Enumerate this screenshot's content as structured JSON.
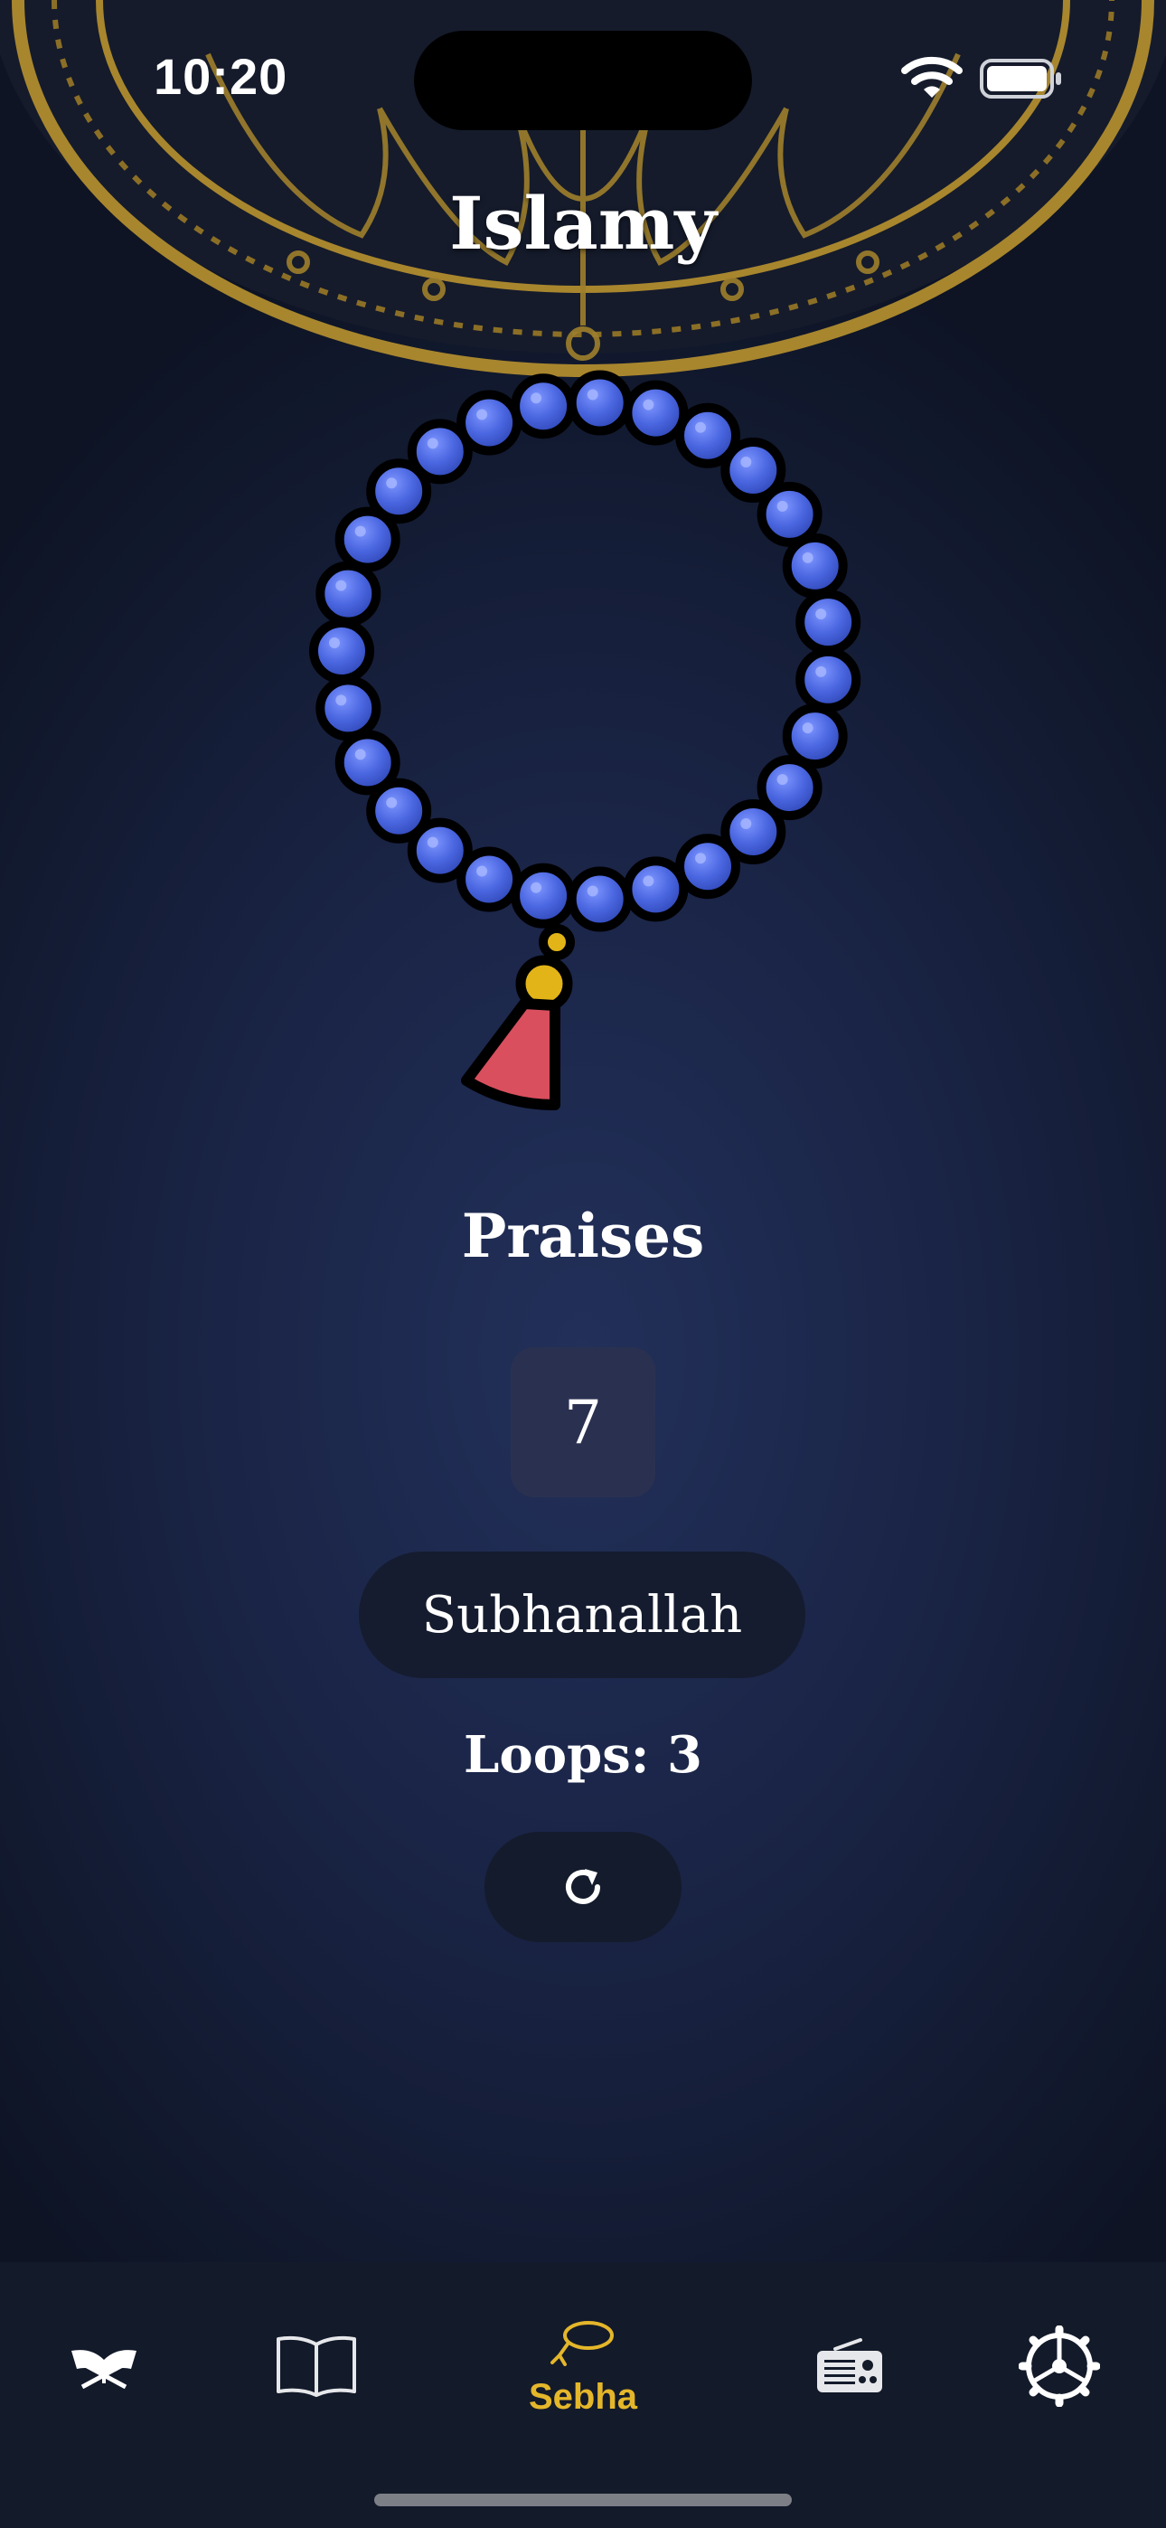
{
  "status_bar": {
    "time": "10:20",
    "icons": [
      "wifi-icon",
      "battery-icon"
    ]
  },
  "app": {
    "title": "Islamy"
  },
  "sebha": {
    "praises_label": "Praises",
    "count": "7",
    "dhikr": "Subhanallah",
    "loops_label": "Loops:",
    "loops_value": "3",
    "reset_icon": "refresh-icon"
  },
  "tabs": [
    {
      "icon": "quran-icon",
      "label": ""
    },
    {
      "icon": "book-icon",
      "label": ""
    },
    {
      "icon": "sebha-icon",
      "label": "Sebha",
      "active": true
    },
    {
      "icon": "radio-icon",
      "label": ""
    },
    {
      "icon": "settings-icon",
      "label": ""
    }
  ],
  "colors": {
    "accent": "#e4b62a",
    "bead": "#4a66e0",
    "tassel": "#d94f5e",
    "background": "#1a2446"
  }
}
